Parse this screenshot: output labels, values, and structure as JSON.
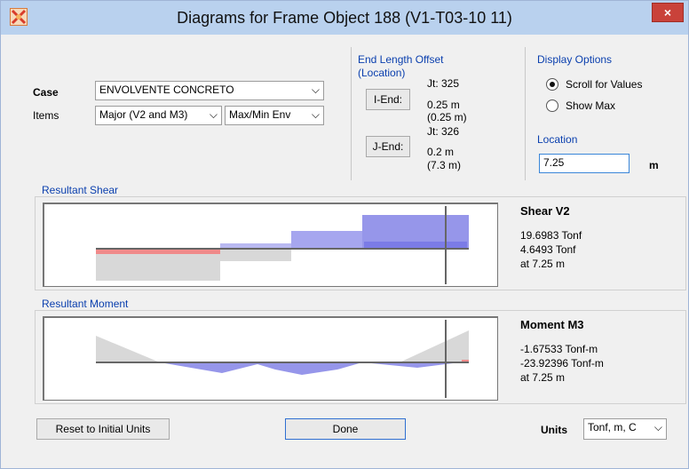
{
  "window": {
    "title": "Diagrams for Frame Object 188  (V1-T03-10 11)",
    "close_label": "×"
  },
  "case": {
    "label": "Case",
    "value": "ENVOLVENTE CONCRETO"
  },
  "items": {
    "label": "Items",
    "component": "Major (V2 and M3)",
    "envelope": "Max/Min Env"
  },
  "end_offset": {
    "title": "End Length Offset",
    "subtitle": "(Location)",
    "iend_button": "I-End:",
    "iend_jt": "Jt:  325",
    "iend_length": "0.25 m",
    "iend_location": "(0.25 m)",
    "jend_button": "J-End:",
    "jend_jt": "Jt:  326",
    "jend_length": "0.2 m",
    "jend_location": "(7.3 m)"
  },
  "display": {
    "title": "Display Options",
    "scroll": "Scroll for Values",
    "show_max": "Show Max",
    "location_title": "Location",
    "location_value": "7.25",
    "location_unit": "m"
  },
  "shear": {
    "section_title": "Resultant Shear",
    "title": "Shear V2",
    "value1": "19.6983 Tonf",
    "value2": "4.6493 Tonf",
    "at": "at 7.25 m"
  },
  "moment": {
    "section_title": "Resultant Moment",
    "title": "Moment M3",
    "value1": "-1.67533 Tonf-m",
    "value2": "-23.92396 Tonf-m",
    "at": "at 7.25 m"
  },
  "buttons": {
    "reset": "Reset to Initial Units",
    "done": "Done"
  },
  "units": {
    "label": "Units",
    "value": "Tonf, m, C"
  },
  "icons": {
    "select_arrow": "⌵",
    "close": "close-icon"
  }
}
